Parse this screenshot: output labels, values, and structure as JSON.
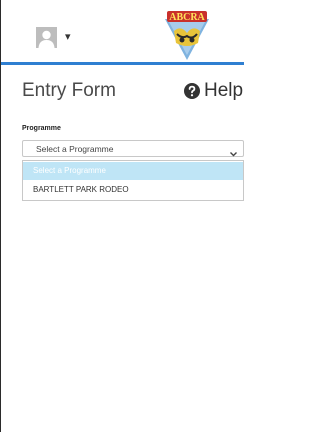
{
  "header": {
    "user_menu_icon": "user-avatar-icon",
    "caret_glyph": "▾",
    "logo_icon": "abcra-logo-icon",
    "logo_text": "ABCRA",
    "accent_color": "#2f7fd1"
  },
  "form": {
    "title": "Entry Form",
    "help_label": "Help",
    "help_icon": "question-circle-icon",
    "programme_label": "Programme",
    "programme_select": {
      "selected_value": "Select a Programme",
      "options": [
        {
          "label": "Select a Programme",
          "selected": true
        },
        {
          "label": "BARTLETT PARK RODEO",
          "selected": false
        }
      ]
    }
  }
}
